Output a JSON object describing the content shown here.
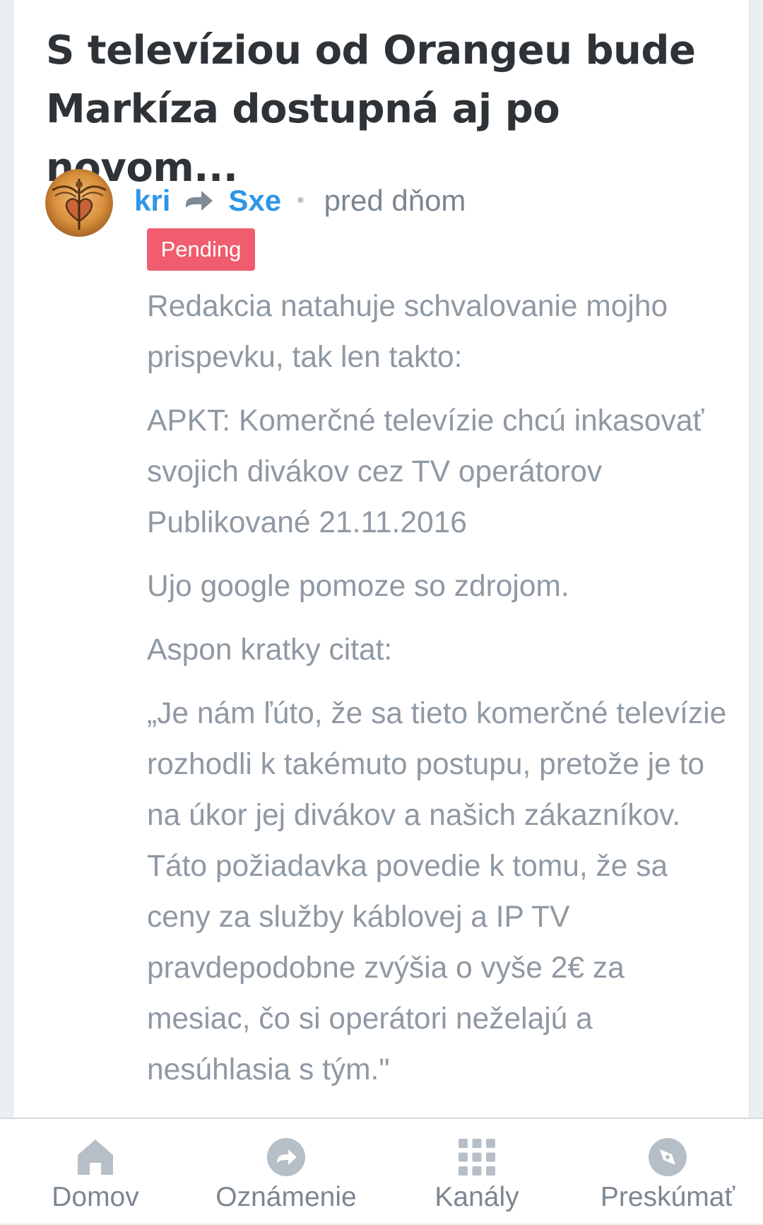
{
  "post": {
    "title": "S televíziou od Orangeu bude Markíza dostupná aj po novom...",
    "author": "kri",
    "target": "Sxe",
    "separator": "•",
    "time": "pred dňom",
    "status_badge": "Pending",
    "paragraphs": [
      "Redakcia natahuje schvalovanie mojho prispevku, tak len takto:",
      "APKT: Komerčné televízie chcú inkasovať svojich divákov cez TV operátorov Publikované 21.11.2016",
      "Ujo google pomoze so zdrojom.",
      "Aspon kratky citat:",
      "„Je nám ľúto, že sa tieto komerčné televízie rozhodli k takémuto postupu, pretože je to na úkor jej divákov a našich zákazníkov. Táto požiadavka povedie k tomu, že sa ceny za služby káblovej a IP TV pravdepodobne zvýšia o vyše 2€ za mesiac, čo si operátori neželajú a nesúhlasia s tým.\""
    ]
  },
  "icons": {
    "author_avatar": "avatar-heart-emblem",
    "direction": "arrow-right-icon",
    "nav_home": "home-icon",
    "nav_share": "share-icon",
    "nav_channels": "grid-icon",
    "nav_explore": "compass-icon"
  },
  "bottom_nav": {
    "items": [
      {
        "label": "Domov"
      },
      {
        "label": "Oznámenie"
      },
      {
        "label": "Kanály"
      },
      {
        "label": "Preskúmať"
      }
    ]
  },
  "colors": {
    "link_blue": "#2f96e6",
    "badge_red": "#ef5d6e",
    "body_text": "#8f99a3",
    "title_text": "#2e3338",
    "nav_text": "#7c8792",
    "nav_icon": "#b6bec7"
  }
}
